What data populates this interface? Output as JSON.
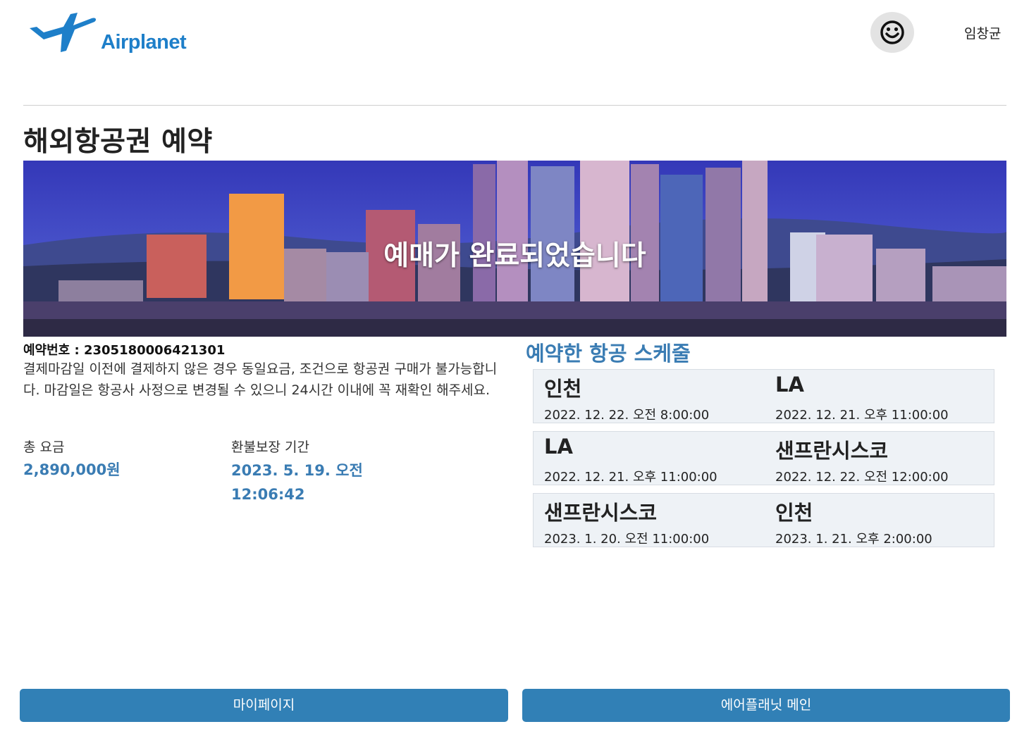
{
  "header": {
    "logo_text": "Airplanet",
    "username": "임창균",
    "brand_color": "#1e7fc9"
  },
  "page": {
    "title": "해외항공권 예약"
  },
  "banner": {
    "message": "예매가 완료되었습니다"
  },
  "reservation": {
    "booking_number": "예약번호 : 2305180006421301",
    "notice": "결제마감일 이전에 결제하지 않은 경우 동일요금, 조건으로 항공권 구매가 불가능합니다. 마감일은 항공사 사정으로 변경될 수 있으니 24시간 이내에 꼭 재확인 해주세요.",
    "fare_label": "총 요금",
    "fare_value": "2,890,000원",
    "refund_label": "환불보장 기간",
    "refund_value": "2023. 5. 19. 오전 12:06:42"
  },
  "schedule": {
    "title": "예약한 항공 스케줄",
    "flights": [
      {
        "from": "인천",
        "from_time": "2022. 12. 22. 오전 8:00:00",
        "to": "LA",
        "to_time": "2022. 12. 21. 오후 11:00:00"
      },
      {
        "from": "LA",
        "from_time": "2022. 12. 21. 오후 11:00:00",
        "to": "샌프란시스코",
        "to_time": "2022. 12. 22. 오전 12:00:00"
      },
      {
        "from": "샌프란시스코",
        "from_time": "2023. 1. 20. 오전 11:00:00",
        "to": "인천",
        "to_time": "2023. 1. 21. 오후 2:00:00"
      }
    ]
  },
  "buttons": {
    "mypage": "마이페이지",
    "main": "에어플래닛 메인",
    "color": "#3180b6"
  },
  "accent_color": "#3a7cb3"
}
